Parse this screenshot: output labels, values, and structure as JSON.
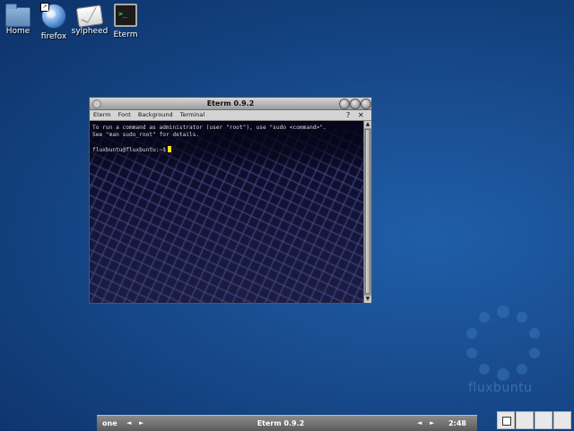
{
  "desktop": {
    "icons": [
      {
        "label": "Home",
        "icon": "folder-icon"
      },
      {
        "label": "firefox",
        "icon": "globe-icon"
      },
      {
        "label": "sylpheed",
        "icon": "mail-icon"
      },
      {
        "label": "Eterm",
        "icon": "terminal-icon",
        "glyph": ">_"
      }
    ]
  },
  "window": {
    "title": "Eterm 0.9.2",
    "menu": [
      "Eterm",
      "Font",
      "Background",
      "Terminal"
    ],
    "help_glyph": "?",
    "close_glyph": "✕",
    "terminal": {
      "line1": "To run a command as administrator (user \"root\"), use \"sudo <command>\".",
      "line2": "See \"man sudo_root\" for details.",
      "prompt": "fluxbuntu@fluxbuntu:~$"
    }
  },
  "watermark": {
    "text": "fluxbuntu"
  },
  "taskbar": {
    "workspace": "one",
    "left_arrow": "◄",
    "right_arrow": "►",
    "task": "Eterm 0.9.2",
    "clock": "2:48"
  },
  "pager": {
    "workspaces": 4,
    "active": 0
  }
}
